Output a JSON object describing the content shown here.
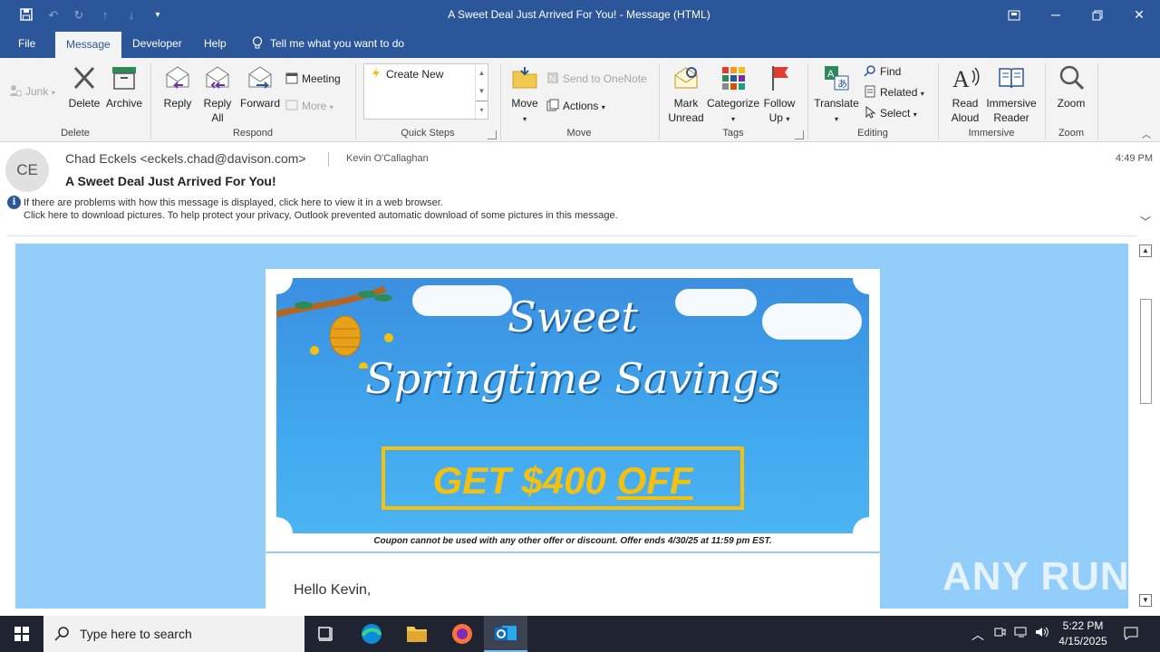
{
  "window": {
    "title": "A Sweet Deal Just Arrived For You!  -  Message (HTML)"
  },
  "tabs": [
    {
      "label": "File"
    },
    {
      "label": "Message"
    },
    {
      "label": "Developer"
    },
    {
      "label": "Help"
    }
  ],
  "tell_me": "Tell me what you want to do",
  "ribbon": {
    "junk": "Junk",
    "delete": "Delete",
    "archive": "Archive",
    "reply": "Reply",
    "reply_all_1": "Reply",
    "reply_all_2": "All",
    "forward": "Forward",
    "meeting": "Meeting",
    "more": "More",
    "create_new": "Create New",
    "move": "Move",
    "send_to_onenote": "Send to OneNote",
    "actions": "Actions",
    "mark_unread_1": "Mark",
    "mark_unread_2": "Unread",
    "categorize": "Categorize",
    "follow_up_1": "Follow",
    "follow_up_2": "Up",
    "translate": "Translate",
    "find": "Find",
    "related": "Related",
    "select": "Select",
    "read_aloud_1": "Read",
    "read_aloud_2": "Aloud",
    "immersive_reader_1": "Immersive",
    "immersive_reader_2": "Reader",
    "zoom": "Zoom",
    "groups": {
      "delete": "Delete",
      "respond": "Respond",
      "quick_steps": "Quick Steps",
      "move": "Move",
      "tags": "Tags",
      "editing": "Editing",
      "immersive": "Immersive",
      "zoom": "Zoom"
    }
  },
  "message": {
    "avatar_initials": "CE",
    "sender": "Chad Eckels <eckels.chad@davison.com>",
    "recipient": "Kevin O'Callaghan",
    "time": "4:49 PM",
    "subject": "A Sweet Deal Just Arrived For You!",
    "info_line_1": "If there are problems with how this message is displayed, click here to view it in a web browser.",
    "info_line_2": "Click here to download pictures. To help protect your privacy, Outlook prevented automatic download of some pictures in this message."
  },
  "email_body": {
    "headline_1": "Sweet",
    "headline_2": "Springtime Savings",
    "offer_main": "GET $400 ",
    "offer_off": "OFF",
    "coupon_note": "Coupon cannot be used with any other offer or discount. Offer ends 4/30/25 at 11:59 pm EST.",
    "greeting": "Hello Kevin,"
  },
  "watermark": "ANY RUN",
  "taskbar": {
    "search_placeholder": "Type here to search",
    "time": "5:22 PM",
    "date": "4/15/2025"
  },
  "colors": {
    "titlebar": "#2b579a",
    "email_background": "#93cdfa",
    "offer_yellow": "#f4c10f",
    "taskbar": "#1f2430"
  }
}
